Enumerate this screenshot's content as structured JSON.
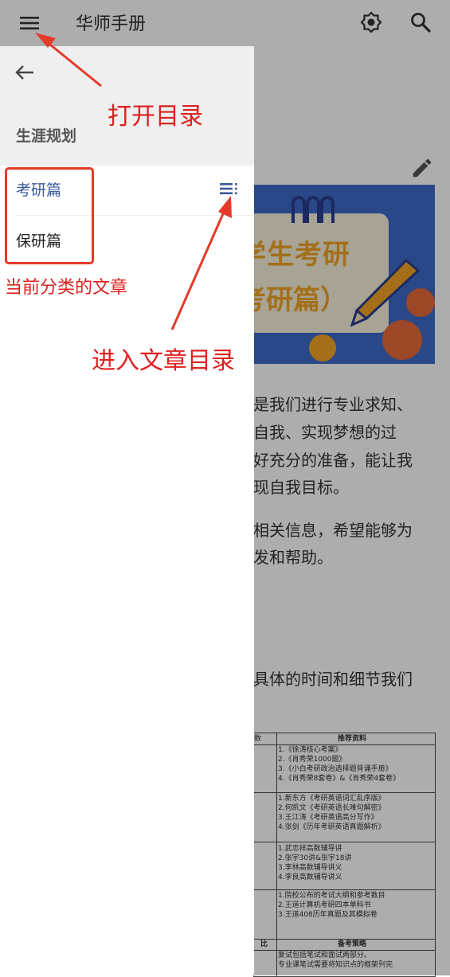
{
  "app_bar": {
    "title": "华师手册"
  },
  "drawer": {
    "section_title": "生涯规划",
    "items": [
      {
        "label": "考研篇",
        "selected": true
      },
      {
        "label": "保研篇",
        "selected": false
      }
    ]
  },
  "article": {
    "banner_line1": "学生考研",
    "banner_line2": "考研篇）",
    "paragraph1": [
      "是我们进行专业求知、",
      "自我、实现梦想的过",
      "好充分的准备，能让我",
      "现自我目标。"
    ],
    "paragraph2": [
      "相关信息，希望能够为",
      "发和帮助。"
    ],
    "paragraph3": [
      "具体的时间和细节我们"
    ],
    "table": {
      "header_right": "推荐资料",
      "header_left": "数",
      "rows": [
        [
          "1.《徐涛核心考案》",
          "2.《肖秀荣1000题》",
          "3.《小白考研政治选择题背诵手册》",
          "4.《肖秀荣8套卷》&《肖秀荣4套卷》"
        ],
        [
          "1.新东方《考研英语词汇乱序版》",
          "2.何凯文《考研英语长难句解密》",
          "3.王江涛《考研英语高分写作》",
          "4.张剑《历年考研英语真题解析》"
        ],
        [
          "1.武忠祥高数辅导讲",
          "2.张宇30讲&张宇18讲",
          "3.李林高数辅导讲义",
          "4.李良高数辅导讲义"
        ],
        [
          "1.院校公布的考试大纲和参考数目",
          "2.王道计算机考研四本单科书",
          "3.王道408历年真题及其模拟卷"
        ]
      ],
      "footer_left": "比",
      "footer_right": "备考策略",
      "footer_lines": [
        "复试包括笔试和面试两部分。",
        "专业课笔试需要将知识点的框架列完"
      ]
    }
  },
  "annotations": {
    "open_menu": "打开目录",
    "current_category": "当前分类的文章",
    "enter_toc": "进入文章目录"
  },
  "colors": {
    "selected_item": "#3a5a9c",
    "annotation_red": "#e02020",
    "banner_blue": "#3e69c9"
  }
}
